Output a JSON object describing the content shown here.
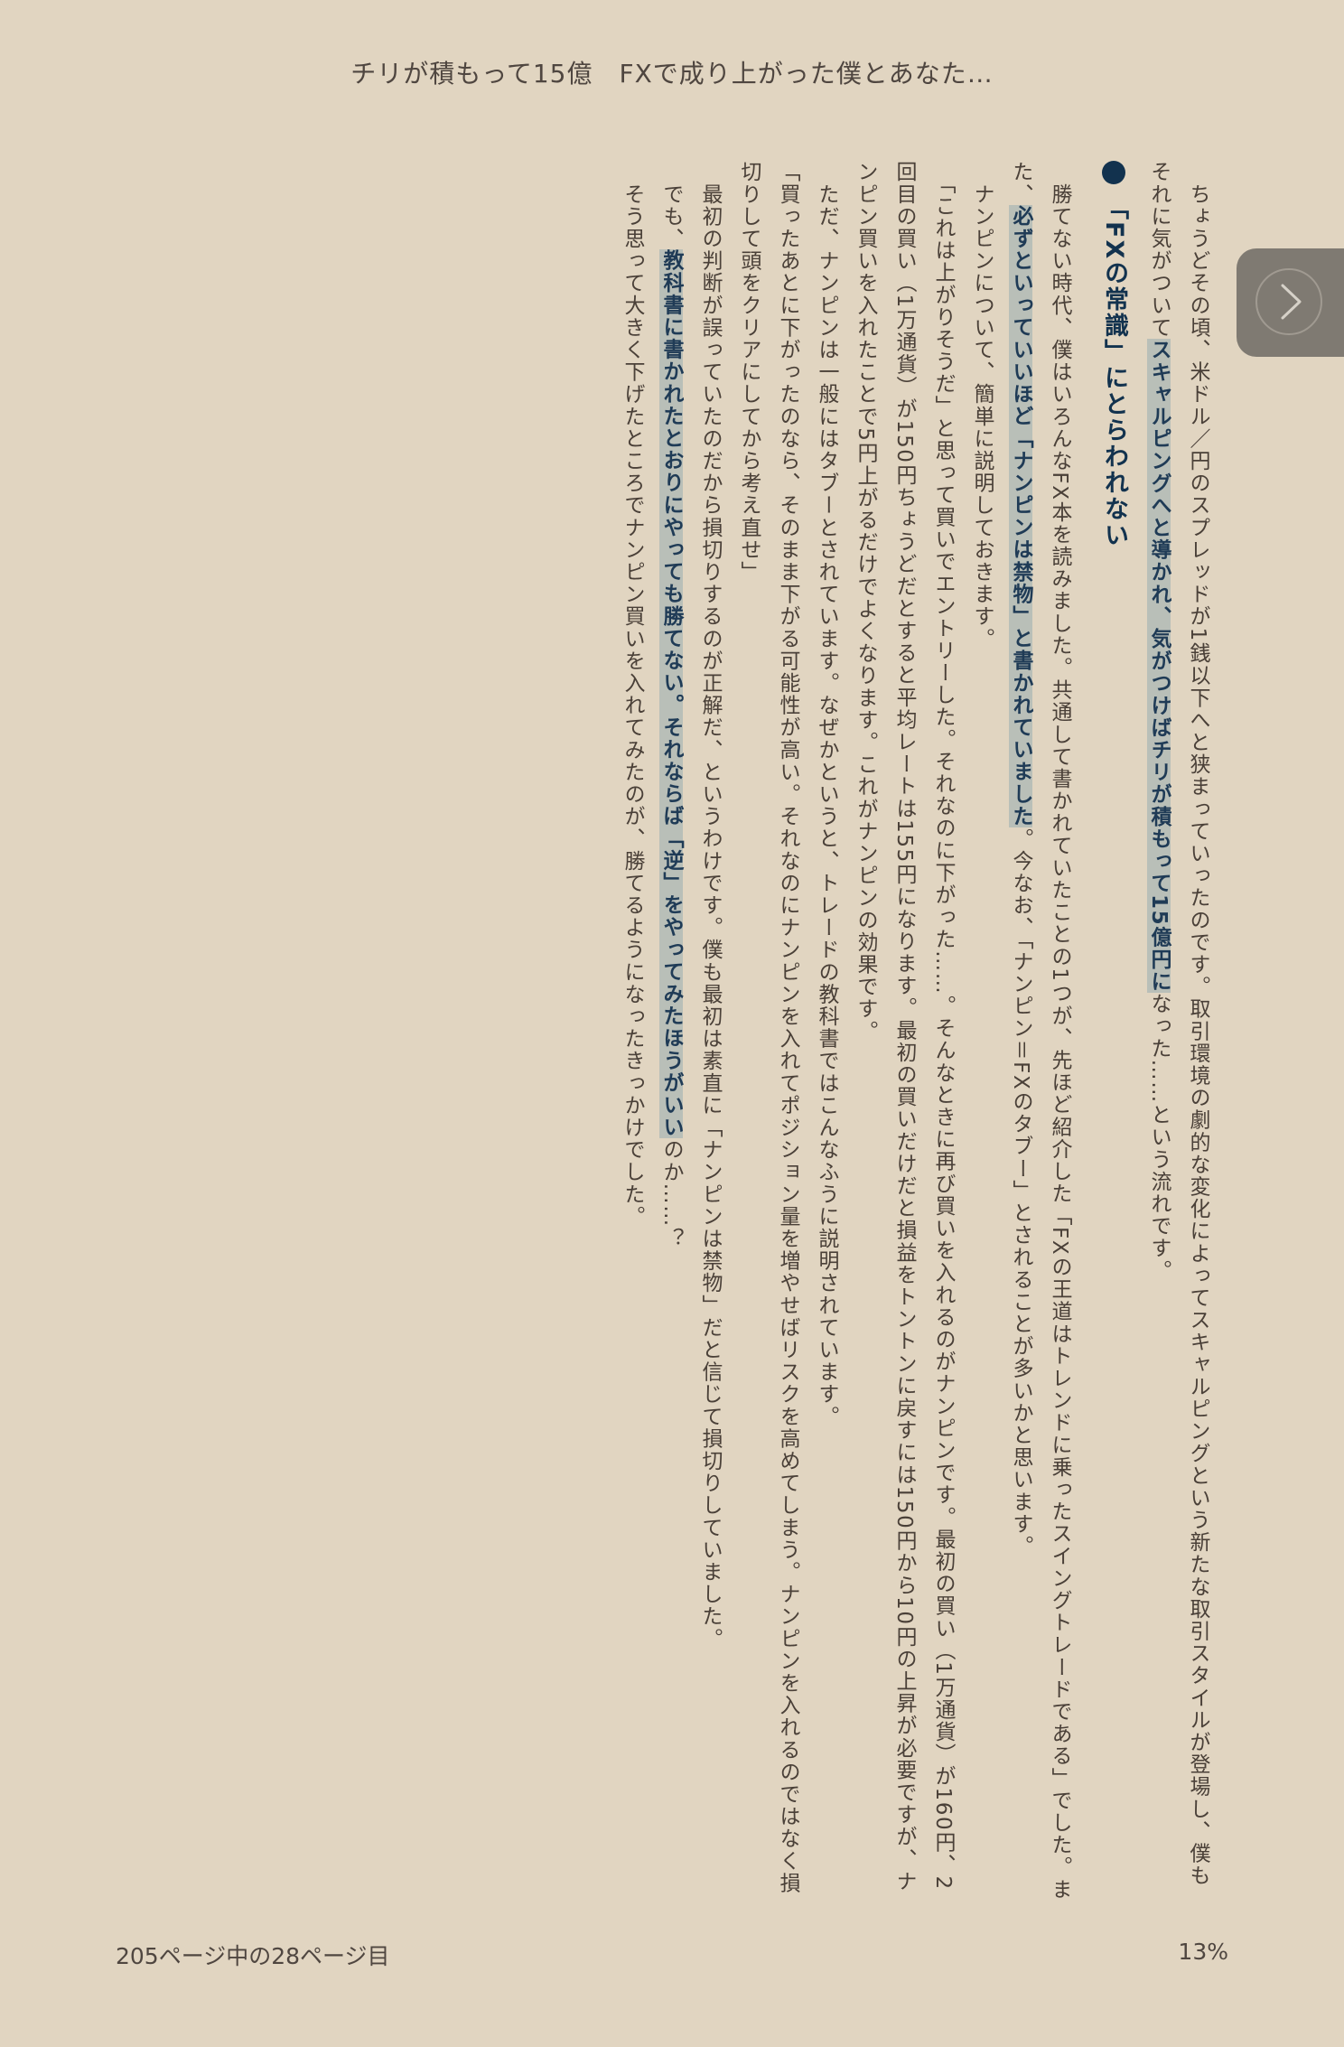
{
  "header": {
    "book_title": "チリが積もって15億　FXで成り上がった僕とあなた…"
  },
  "content": {
    "p1_a": "ちょうどその頃、米ドル／円のスプレッドが1銭以下へと狭まっていったのです。取引環境の劇的な変化によってスキャルピングという新たな取引スタイルが登場し、僕もそれに気がついて",
    "p1_hl": "スキャルピングへと導かれ、気がつけばチリが積もって15億円に",
    "p1_b": "なった……という流れです。",
    "heading": "「FXの常識」にとらわれない",
    "p2_a": "勝てない時代、僕はいろんなFX本を読みました。共通して書かれていたことの1つが、先ほど紹介した「FXの王道はトレンドに乗ったスイングトレードである」でした。また、",
    "p2_hl": "必ずといっていいほど「ナンピンは禁物」と書かれていました",
    "p2_b": "。今なお、「ナンピン＝FXのタブー」とされることが多いかと思います。",
    "p3": "ナンピンについて、簡単に説明しておきます。",
    "p4": "「これは上がりそうだ」と思って買いでエントリーした。それなのに下がった……。そんなときに再び買いを入れるのがナンピンです。最初の買い（1万通貨）が160円、2回目の買い（1万通貨）が150円ちょうどだとすると平均レートは155円になります。最初の買いだけだと損益をトントンに戻すには150円から10円の上昇が必要ですが、ナンピン買いを入れたことで5円上がるだけでよくなります。これがナンピンの効果です。",
    "p5": "ただ、ナンピンは一般にはタブーとされています。なぜかというと、トレードの教科書ではこんなふうに説明されています。",
    "p6": "「買ったあとに下がったのなら、そのまま下がる可能性が高い。それなのにナンピンを入れてポジション量を増やせばリスクを高めてしまう。ナンピンを入れるのではなく損切りして頭をクリアにしてから考え直せ」",
    "p7": "最初の判断が誤っていたのだから損切りするのが正解だ、というわけです。僕も最初は素直に「ナンピンは禁物」だと信じて損切りしていました。",
    "p8_a": "でも、",
    "p8_hl": "教科書に書かれたとおりにやっても勝てない。それならば「逆」をやってみたほうがいい",
    "p8_b": "のか……？",
    "p9": "そう思って大きく下げたところでナンピン買いを入れてみたのが、勝てるようになったきっかけでした。"
  },
  "footer": {
    "page_info": "205ページ中の28ページ目",
    "progress_label": "13%"
  },
  "icons": {
    "next_page": "chevron-right-icon"
  },
  "colors": {
    "page_background": "#e1d5c1",
    "highlight_background": "#b9bfb8",
    "heading_color": "#12324e"
  }
}
